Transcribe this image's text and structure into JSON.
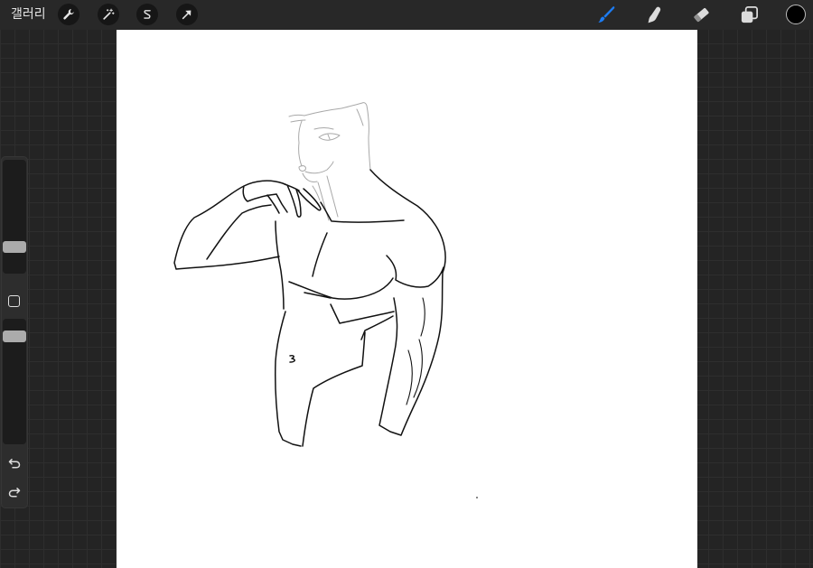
{
  "toolbar": {
    "gallery_label": "갤러리",
    "left_tools": [
      "wrench-icon",
      "magic-wand-icon",
      "selection-icon",
      "transform-arrow-icon"
    ],
    "right_tools": [
      {
        "icon": "brush-icon",
        "active": true
      },
      {
        "icon": "smudge-icon",
        "active": false
      },
      {
        "icon": "eraser-icon",
        "active": false
      },
      {
        "icon": "layers-icon",
        "active": false
      }
    ],
    "current_color": "#000000"
  },
  "sidebar": {
    "brush_size_level": 0.2,
    "opacity_level": 0.9,
    "icons": [
      "square-icon",
      "undo-icon",
      "redo-icon"
    ]
  },
  "canvas": {
    "background": "#ffffff",
    "ink_color": "#111111",
    "sketch_color": "#a8a8a8"
  },
  "colors": {
    "accent": "#1d7cf2",
    "icon": "#dcdcdc"
  }
}
